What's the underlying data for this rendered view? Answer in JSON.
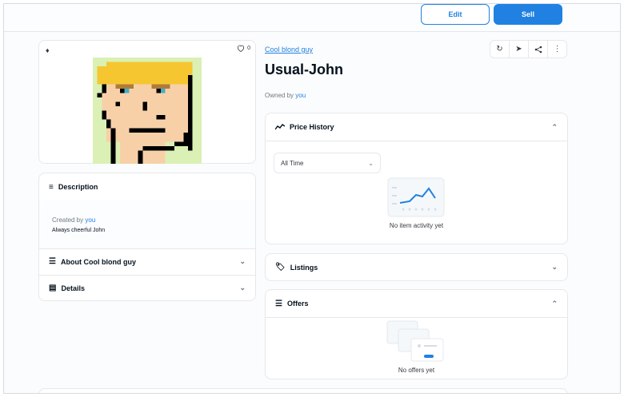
{
  "header": {
    "edit_label": "Edit",
    "sell_label": "Sell"
  },
  "asset": {
    "favorites_count": "0",
    "collection": "Cool blond guy",
    "title": "Usual-John",
    "owned_prefix": "Owned by",
    "owner": "you"
  },
  "description": {
    "heading": "Description",
    "created_prefix": "Created by",
    "creator": "you",
    "text": "Always cheerful John"
  },
  "about": {
    "heading": "About Cool blond guy"
  },
  "details": {
    "heading": "Details"
  },
  "price_history": {
    "heading": "Price History",
    "filter_value": "All Time",
    "empty_text": "No item activity yet"
  },
  "listings": {
    "heading": "Listings"
  },
  "offers": {
    "heading": "Offers",
    "empty_text": "No offers yet"
  },
  "colors": {
    "accent": "#2081e2",
    "border": "#e5e8eb",
    "text": "#04111d",
    "muted": "#707a83",
    "punk_bg": "#dbf0b4",
    "hair": "#f6c630",
    "skin": "#f8d0a8"
  }
}
